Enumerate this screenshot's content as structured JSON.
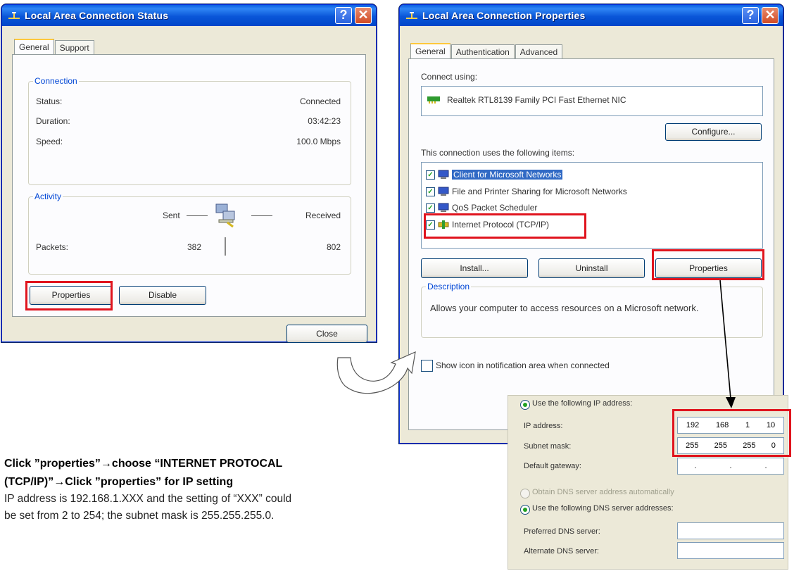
{
  "status_window": {
    "title": "Local Area Connection Status",
    "help_glyph": "?",
    "close_glyph": "✕",
    "tabs": [
      "General",
      "Support"
    ],
    "connection": {
      "label": "Connection",
      "rows": [
        {
          "label": "Status:",
          "value": "Connected"
        },
        {
          "label": "Duration:",
          "value": "03:42:23"
        },
        {
          "label": "Speed:",
          "value": "100.0 Mbps"
        }
      ]
    },
    "activity": {
      "label": "Activity",
      "sent": "Sent",
      "received": "Received",
      "packets_label": "Packets:",
      "packets_sent": "382",
      "packets_received": "802"
    },
    "properties_button": "Properties",
    "disable_button": "Disable",
    "close_button": "Close"
  },
  "properties_window": {
    "title": "Local Area Connection Properties",
    "help_glyph": "?",
    "close_glyph": "✕",
    "tabs": [
      "General",
      "Authentication",
      "Advanced"
    ],
    "connect_using_label": "Connect using:",
    "adapter_name": "Realtek RTL8139 Family PCI Fast Ethernet NIC",
    "configure_button": "Configure...",
    "items_label": "This connection uses the following items:",
    "items": [
      {
        "label": "Client for Microsoft Networks",
        "checked": true
      },
      {
        "label": "File and Printer Sharing for Microsoft Networks",
        "checked": true
      },
      {
        "label": "QoS Packet Scheduler",
        "checked": true
      },
      {
        "label": "Internet Protocol (TCP/IP)",
        "checked": true
      }
    ],
    "install_button": "Install...",
    "uninstall_button": "Uninstall",
    "properties_button": "Properties",
    "description_label": "Description",
    "description_text": "Allows your computer to access resources on a Microsoft network.",
    "show_icon_label": "Show icon in notification area when connected",
    "check_glyph": "✓"
  },
  "tcpip_panel": {
    "use_following_ip": "Use the following IP address:",
    "ip_label": "IP address:",
    "ip_value": [
      "192",
      "168",
      "1",
      "10"
    ],
    "subnet_label": "Subnet mask:",
    "subnet_value": [
      "255",
      "255",
      "255",
      "0"
    ],
    "gateway_label": "Default gateway:",
    "gateway_value": [
      ".",
      ".",
      "."
    ],
    "obtain_dns": "Obtain DNS server address automatically",
    "use_following_dns": "Use the following DNS server addresses:",
    "preferred_dns": "Preferred DNS server:",
    "alternate_dns": "Alternate DNS server:"
  },
  "caption": {
    "line1": "Click ”properties”→choose “INTERNET PROTOCAL",
    "line2": "(TCP/IP)”→Click ”properties” for IP setting",
    "line3": "IP address is 192.168.1.XXX and the setting of “XXX” could",
    "line4": "be set from 2 to 254; the subnet mask is 255.255.255.0."
  },
  "colors": {
    "title_blue": "#0a56d8",
    "highlight_red": "#e0141e",
    "selection_blue": "#316ac5"
  }
}
